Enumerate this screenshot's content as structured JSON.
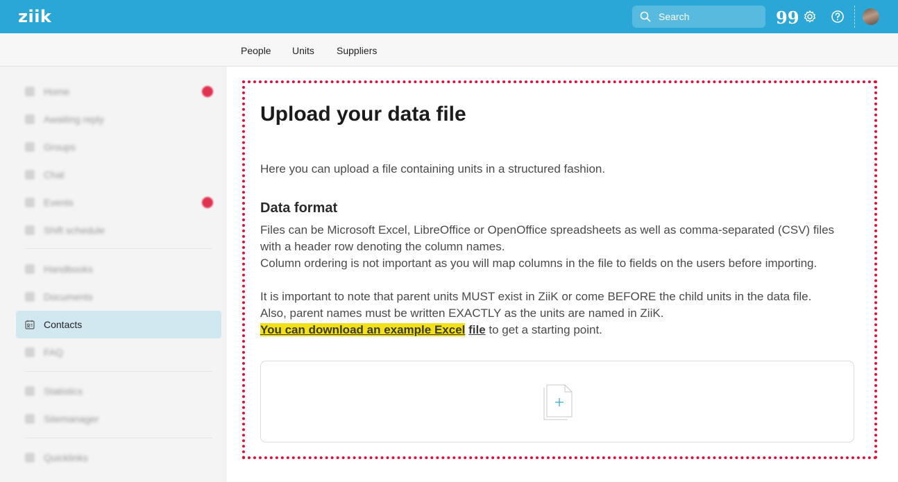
{
  "app": {
    "logo": "ziik"
  },
  "header": {
    "search_placeholder": "Search",
    "icons": [
      "search-icon",
      "quote-icon",
      "gear-icon",
      "help-icon",
      "avatar"
    ],
    "quote_glyph": "99",
    "accent_color": "#2aa7d6"
  },
  "subnav": {
    "tabs": [
      "People",
      "Units",
      "Suppliers"
    ]
  },
  "sidebar": {
    "items": [
      {
        "label": "Home",
        "icon": "home-icon",
        "badge": true
      },
      {
        "label": "Awaiting reply",
        "icon": "bell-icon",
        "badge": false
      },
      {
        "label": "Groups",
        "icon": "groups-icon",
        "badge": false
      },
      {
        "label": "Chat",
        "icon": "chat-icon",
        "badge": false
      },
      {
        "label": "Events",
        "icon": "calendar-icon",
        "badge": true
      },
      {
        "label": "Shift schedule",
        "icon": "schedule-icon",
        "badge": false
      },
      {
        "label": "Handbooks",
        "icon": "book-icon",
        "badge": false
      },
      {
        "label": "Documents",
        "icon": "document-icon",
        "badge": false
      },
      {
        "label": "Contacts",
        "icon": "contacts-icon",
        "badge": false,
        "active": true
      },
      {
        "label": "FAQ",
        "icon": "faq-icon",
        "badge": false
      },
      {
        "label": "Statistics",
        "icon": "chart-icon",
        "badge": false
      },
      {
        "label": "Sitemanager",
        "icon": "person-icon",
        "badge": false
      },
      {
        "label": "Quicklinks",
        "icon": "link-icon",
        "badge": false
      }
    ]
  },
  "main": {
    "title": "Upload your data file",
    "intro": "Here you can upload a file containing units in a structured fashion.",
    "format_heading": "Data format",
    "format_line1": "Files can be Microsoft Excel, LibreOffice or OpenOffice spreadsheets as well as comma-separated (CSV) files",
    "format_line2": "with a header row denoting the column names.",
    "format_line3": "Column ordering is not important as you will map columns in the file to fields on the users before importing.",
    "note_line1": "It is important to note that parent units MUST exist in ZiiK or come BEFORE the child units in the data file.",
    "note_line2": "Also, parent names must be written EXACTLY as the units are named in ZiiK.",
    "download_link_highlighted": "You can download an example Excel",
    "download_link_tail": "file",
    "download_suffix": " to get a starting point.",
    "dropzone_icon": "add-file-icon"
  }
}
